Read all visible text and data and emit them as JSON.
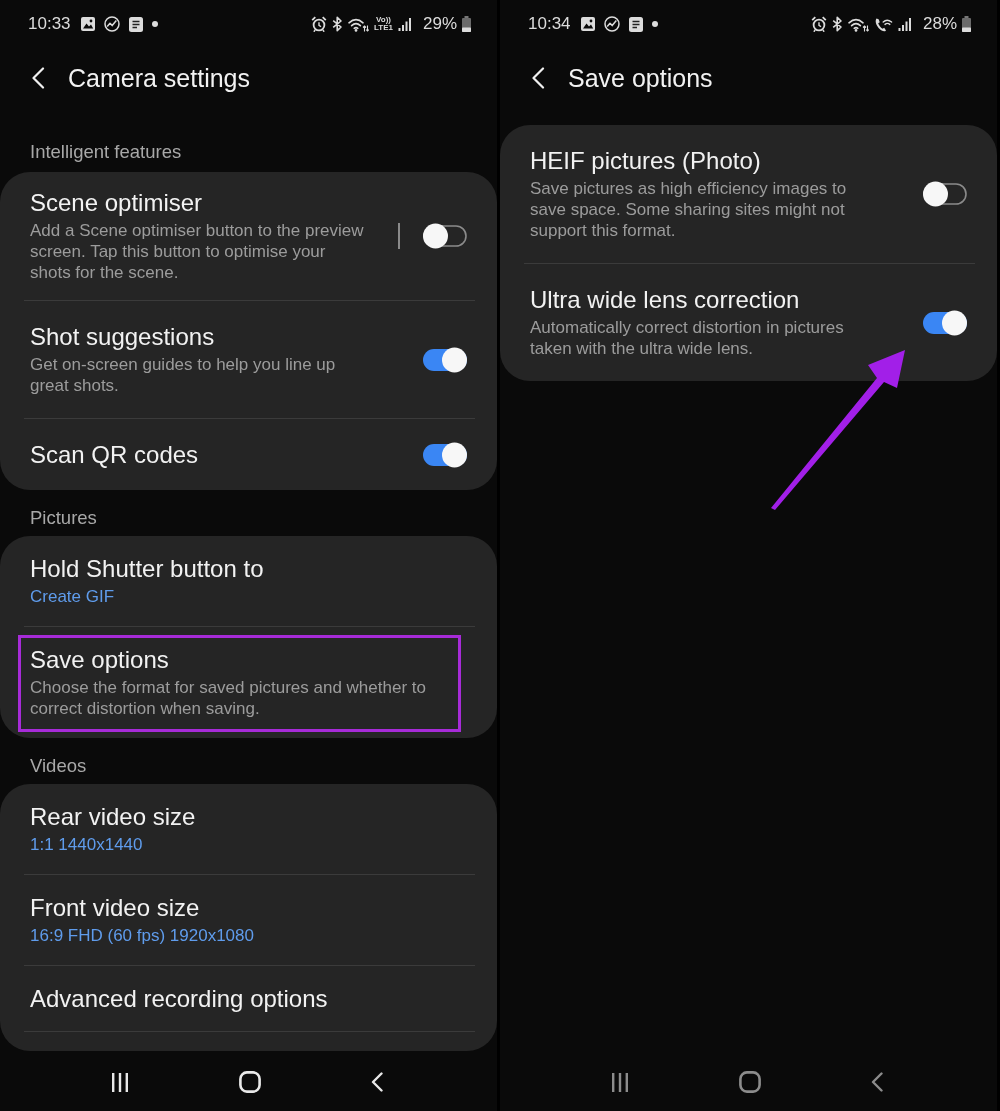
{
  "screens": [
    {
      "status_bar": {
        "time": "10:33",
        "network_label": [
          "Vo))",
          "LTE1"
        ],
        "battery": "29%"
      },
      "header": {
        "title": "Camera settings"
      },
      "sections": [
        {
          "heading": "Intelligent features",
          "continues": false,
          "items": [
            {
              "kind": "split-toggle",
              "title": "Scene optimiser",
              "description": "Add a Scene optimiser button to the preview screen. Tap this button to optimise your shots for the scene.",
              "on": false,
              "highlighted": false,
              "arrow": false
            },
            {
              "kind": "toggle",
              "title": "Shot suggestions",
              "description": "Get on-screen guides to help you line up great shots.",
              "on": true,
              "highlighted": false,
              "arrow": false
            },
            {
              "kind": "toggle",
              "title": "Scan QR codes",
              "on": true,
              "highlighted": false,
              "arrow": false
            }
          ]
        },
        {
          "heading": "Pictures",
          "continues": false,
          "items": [
            {
              "kind": "choice",
              "title": "Hold Shutter button to",
              "value": "Create GIF",
              "highlighted": false,
              "arrow": false
            },
            {
              "kind": "page",
              "title": "Save options",
              "description": "Choose the format for saved pictures and whether to correct distortion when saving.",
              "highlighted": true,
              "arrow": false
            }
          ]
        },
        {
          "heading": "Videos",
          "continues": true,
          "items": [
            {
              "kind": "choice",
              "title": "Rear video size",
              "value": "1:1 1440x1440",
              "highlighted": false,
              "arrow": false
            },
            {
              "kind": "choice",
              "title": "Front video size",
              "value": "16:9 FHD (60 fps) 1920x1080",
              "highlighted": false,
              "arrow": false
            },
            {
              "kind": "page",
              "title": "Advanced recording options",
              "highlighted": false,
              "arrow": false
            }
          ]
        }
      ],
      "nav_bar": {
        "dimmed": false
      }
    },
    {
      "status_bar": {
        "time": "10:34",
        "battery": "28%"
      },
      "header": {
        "title": "Save options"
      },
      "sections": [
        {
          "continues": false,
          "items": [
            {
              "kind": "toggle",
              "title": "HEIF pictures (Photo)",
              "description": "Save pictures as high efficiency images to save space. Some sharing sites might not support this format.",
              "on": false,
              "highlighted": false,
              "arrow": false
            },
            {
              "kind": "toggle",
              "title": "Ultra wide lens correction",
              "description": "Automatically correct distortion in pictures taken with the ultra wide lens.",
              "on": true,
              "highlighted": false,
              "arrow": true
            }
          ]
        }
      ],
      "nav_bar": {
        "dimmed": true
      }
    }
  ]
}
